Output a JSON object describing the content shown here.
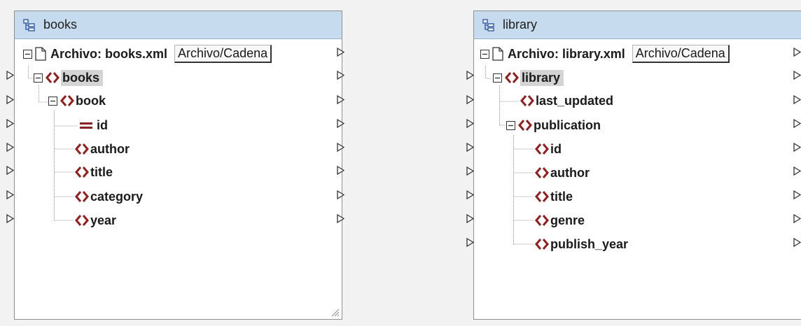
{
  "components": [
    {
      "title": "books",
      "file_label": "Archivo: books.xml",
      "file_button": "Archivo/Cadena",
      "root": "books",
      "element": "book",
      "children": [
        "id",
        "author",
        "title",
        "category",
        "year"
      ]
    },
    {
      "title": "library",
      "file_label": "Archivo: library.xml",
      "file_button": "Archivo/Cadena",
      "root": "library",
      "sibling": "last_updated",
      "element": "publication",
      "children": [
        "id",
        "author",
        "title",
        "genre",
        "publish_year"
      ]
    }
  ],
  "colors": {
    "title_bg": "#c7dbef",
    "element_icon": "#9b1b1b",
    "highlight": "#d4d4d4"
  }
}
